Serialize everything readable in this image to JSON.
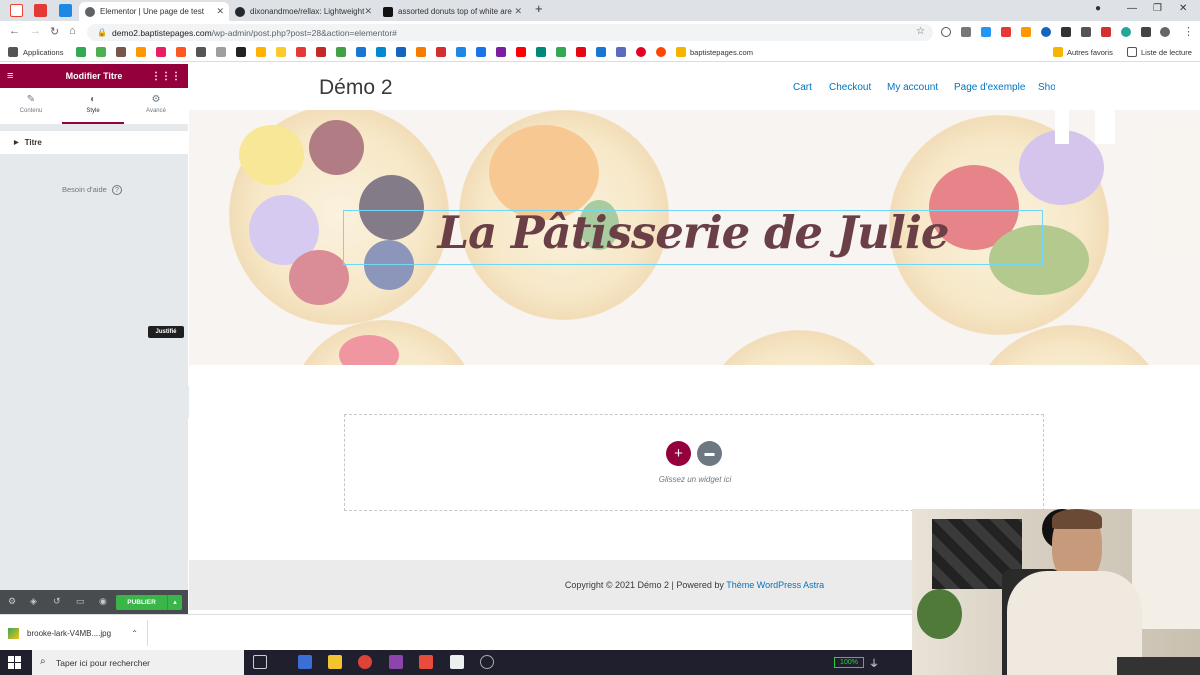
{
  "browser": {
    "tabs": [
      {
        "title": "Elementor | Une page de test",
        "active": true
      },
      {
        "title": "dixonandmoe/rellax: Lightweight",
        "active": false
      },
      {
        "title": "assorted donuts top of white are",
        "active": false
      }
    ],
    "new_tab": "+",
    "url_host": "demo2.baptistepages.com",
    "url_path": "/wp-admin/post.php?post=28&action=elementor#",
    "bookmarks": {
      "apps_label": "Applications",
      "site_label": "baptistepages.com",
      "other_label": "Autres favoris",
      "reading_label": "Liste de lecture"
    }
  },
  "panel": {
    "header_title": "Modifier Titre",
    "tabs": [
      {
        "label": "Contenu",
        "icon": "pencil-icon"
      },
      {
        "label": "Style",
        "icon": "contrast-icon"
      },
      {
        "label": "Avancé",
        "icon": "gear-icon"
      }
    ],
    "section_label": "Titre",
    "help_label": "Besoin d'aide",
    "tooltip": "Justifié",
    "publish_label": "PUBLIER"
  },
  "site": {
    "title": "Démo 2",
    "nav": [
      "Cart",
      "Checkout",
      "My account",
      "Page d'exemple",
      "Shop"
    ],
    "hero_title": "La Pâtisserie de Julie",
    "drop_text": "Glissez un widget ici",
    "footer_text": "Copyright © 2021 Démo 2 | Powered by",
    "footer_link": "Thème WordPress Astra"
  },
  "downloads": {
    "file": "brooke-lark-V4MB....jpg"
  },
  "taskbar": {
    "search_placeholder": "Taper ici pour rechercher",
    "battery": "100%"
  },
  "colors": {
    "elementor_accent": "#93003c",
    "publish_green": "#39b54a",
    "link_blue": "#0274be"
  }
}
